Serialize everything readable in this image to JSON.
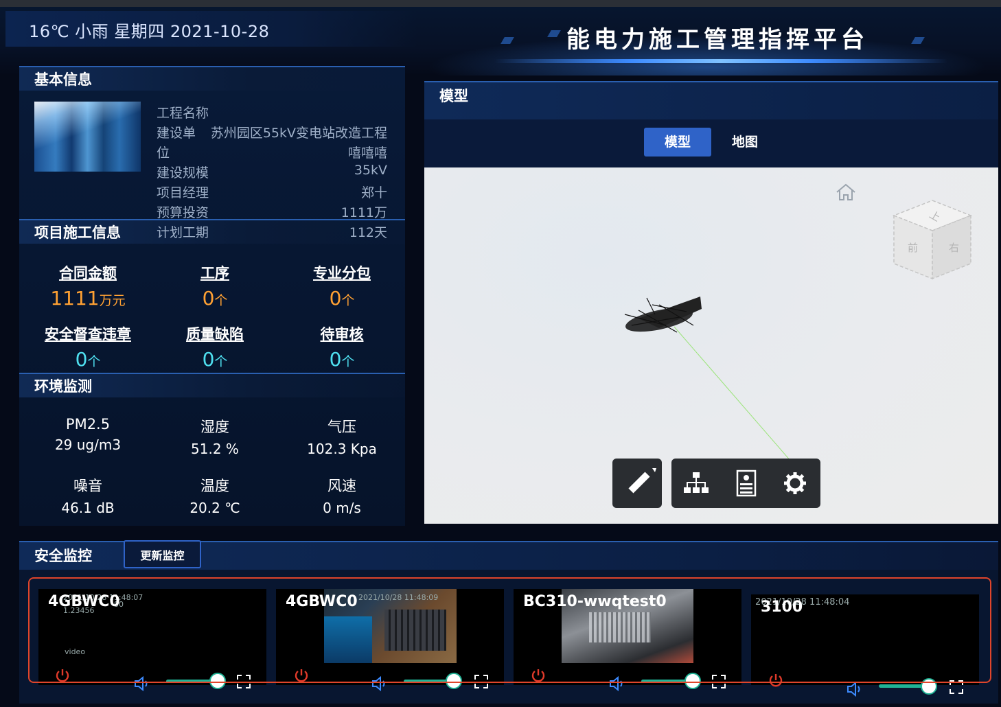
{
  "header": {
    "weather": "16℃ 小雨 星期四 2021-10-28",
    "title": "能电力施工管理指挥平台"
  },
  "basic_info": {
    "title": "基本信息",
    "rows": [
      {
        "k": "工程名称",
        "v": ""
      },
      {
        "k": "建设单",
        "v": "苏州园区55kV变电站改造工程"
      },
      {
        "k": "位",
        "v": "嘻嘻嘻"
      },
      {
        "k": "建设规模",
        "v": "35kV"
      },
      {
        "k": "项目经理",
        "v": "郑十"
      },
      {
        "k": "预算投资",
        "v": "1111万"
      },
      {
        "k": "计划工期",
        "v": "112天"
      }
    ]
  },
  "construction": {
    "title": "项目施工信息",
    "stats": [
      {
        "label": "合同金额",
        "value": "1111",
        "unit": "万元"
      },
      {
        "label": "工序",
        "value": "0",
        "unit": "个"
      },
      {
        "label": "专业分包",
        "value": "0",
        "unit": "个"
      },
      {
        "label": "安全督查违章",
        "value": "0",
        "unit": "个"
      },
      {
        "label": "质量缺陷",
        "value": "0",
        "unit": "个"
      },
      {
        "label": "待审核",
        "value": "0",
        "unit": "个"
      }
    ]
  },
  "environment": {
    "title": "环境监测",
    "items": [
      {
        "label": "PM2.5",
        "value": "29 ug/m3"
      },
      {
        "label": "湿度",
        "value": "51.2 %"
      },
      {
        "label": "气压",
        "value": "102.3 Kpa"
      },
      {
        "label": "噪音",
        "value": "46.1 dB"
      },
      {
        "label": "温度",
        "value": "20.2 ℃"
      },
      {
        "label": "风速",
        "value": "0 m/s"
      }
    ]
  },
  "model": {
    "title": "模型",
    "tabs": [
      "模型",
      "地图"
    ],
    "cube_labels": {
      "top": "上",
      "front": "前",
      "right": "右"
    },
    "tools": [
      "ruler-icon",
      "hierarchy-icon",
      "properties-icon",
      "settings-icon"
    ]
  },
  "monitor": {
    "title": "安全监控",
    "update_label": "更新监控",
    "cameras": [
      {
        "name": "4GBWC0",
        "stamp": "2021/10/28 11:48:07",
        "stamp2": "1.23456",
        "stamp3": "00",
        "caption": "video",
        "volume": 0.88
      },
      {
        "name": "4GBWC0",
        "stamp": "2021/10/28 11:48:09",
        "volume": 0.86
      },
      {
        "name": "BC310-wwqtest0",
        "volume": 0.88
      },
      {
        "name": "3100",
        "stamp": "2021/10/28 11:48:04",
        "volume": 0.86
      }
    ]
  },
  "colors": {
    "accent": "#2f63c8",
    "orange": "#ffa133",
    "cyan": "#4fe0f0",
    "highlight": "#e0452b"
  }
}
